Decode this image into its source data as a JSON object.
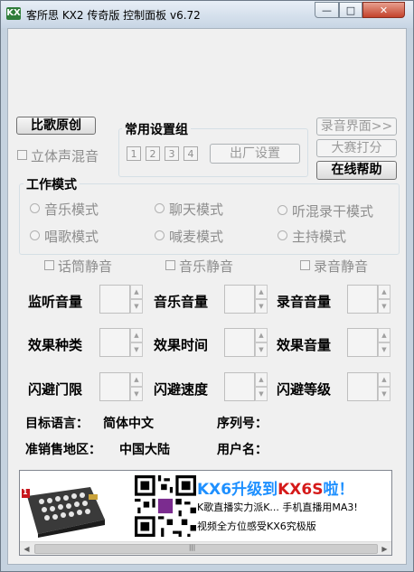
{
  "window": {
    "app_icon": "KX",
    "title": "客所思 KX2 传奇版  控制面板 v6.72",
    "controls": {
      "minimize": "—",
      "maximize": "□",
      "close": "✕"
    }
  },
  "buttons": {
    "compare_original": "比歌原创",
    "record_ui": "录音界面>>",
    "contest_score": "大赛打分",
    "online_help": "在线帮助",
    "factory_settings": "出厂设置"
  },
  "checkboxes": {
    "stereo_mix": "立体声混音",
    "mic_mute": "话筒静音",
    "music_mute": "音乐静音",
    "record_mute": "录音静音"
  },
  "presets": {
    "title": "常用设置组",
    "items": [
      "1",
      "2",
      "3",
      "4"
    ]
  },
  "work_mode": {
    "title": "工作模式",
    "modes": [
      "音乐模式",
      "聊天模式",
      "听混录干模式",
      "唱歌模式",
      "喊麦模式",
      "主持模式"
    ]
  },
  "controls": {
    "monitor_volume": "监听音量",
    "music_volume": "音乐音量",
    "record_volume": "录音音量",
    "effect_type": "效果种类",
    "effect_time": "效果时间",
    "effect_volume": "效果音量",
    "ducking_threshold": "闪避门限",
    "ducking_speed": "闪避速度",
    "ducking_level": "闪避等级"
  },
  "info": {
    "target_language_label": "目标语言：",
    "target_language_value": "简体中文",
    "serial_label": "序列号：",
    "region_label": "准销售地区：",
    "region_value": "中国大陆",
    "user_label": "用户名："
  },
  "ad": {
    "badge": "1",
    "headline_prefix": "KX6升级到",
    "headline_red": "KX6S",
    "headline_suffix": "啦！",
    "line2": "K歌直播实力派K...  手机直播用MA3!",
    "line3": "视频全方位感受KX6究极版"
  }
}
